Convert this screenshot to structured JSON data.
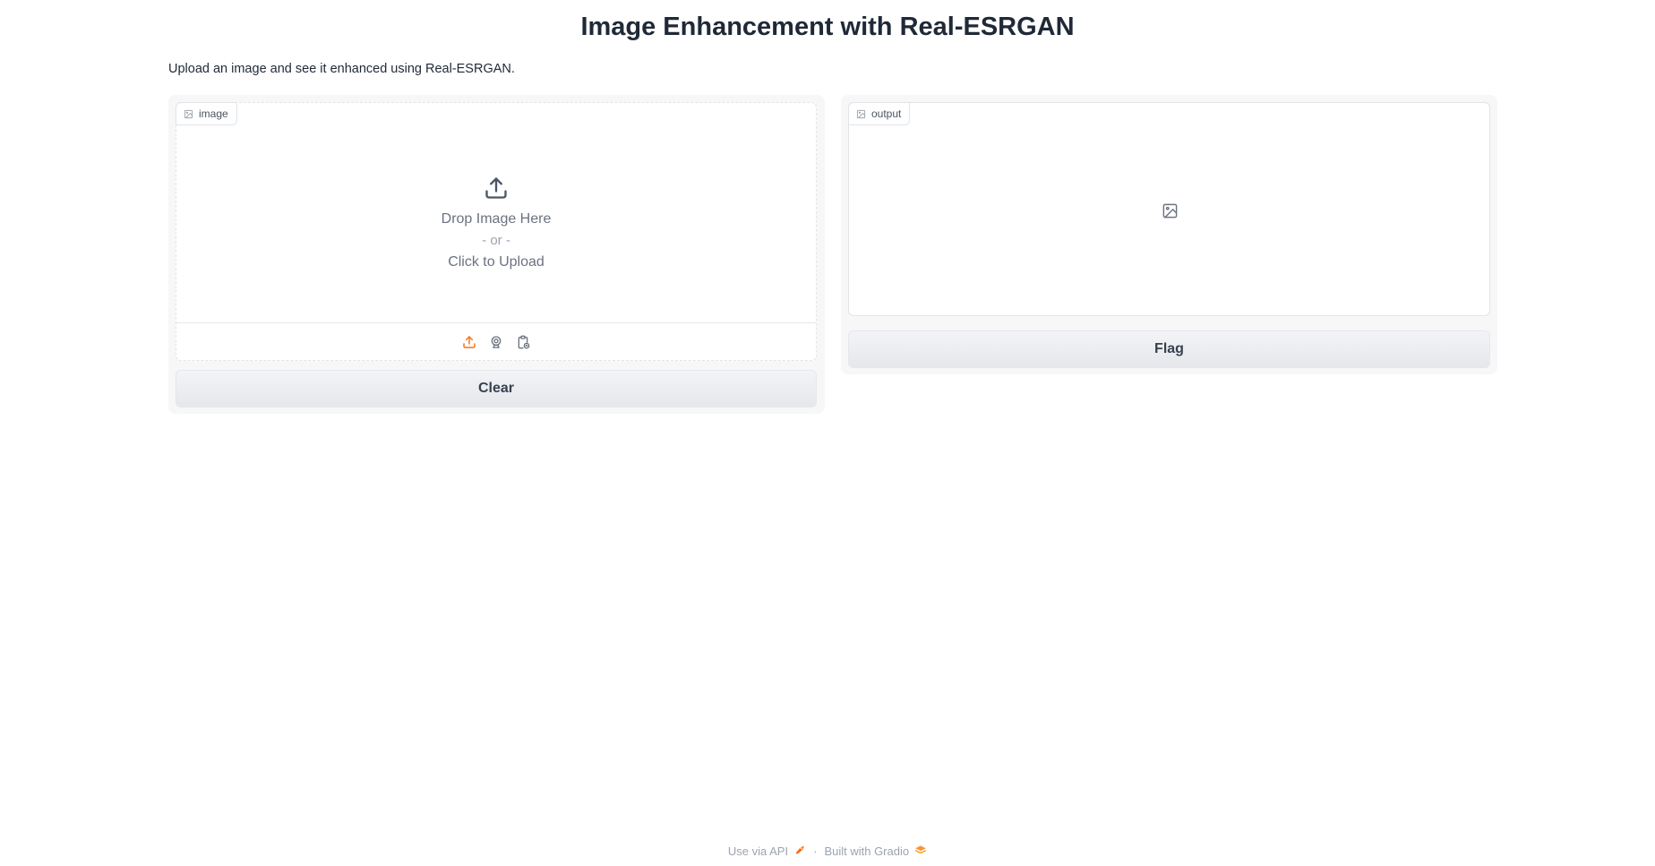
{
  "page": {
    "title": "Image Enhancement with Real-ESRGAN",
    "description": "Upload an image and see it enhanced using Real-ESRGAN."
  },
  "input": {
    "label": "image",
    "drop_text": "Drop Image Here",
    "or_text": "- or -",
    "click_text": "Click to Upload",
    "sources": [
      "upload-icon",
      "webcam-icon",
      "clipboard-icon"
    ],
    "active_source_color": "#f97316"
  },
  "output": {
    "label": "output",
    "placeholder_icon": "image-icon"
  },
  "buttons": {
    "clear": "Clear",
    "flag": "Flag"
  },
  "footer": {
    "api_text": "Use via API",
    "api_icon": "rocket-icon",
    "separator": "·",
    "built_text": "Built with Gradio",
    "built_icon": "gradio-logo-icon"
  }
}
